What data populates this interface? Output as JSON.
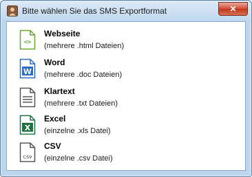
{
  "window": {
    "title": "Bitte wählen Sie das SMS Exportformat",
    "close_glyph": "✕"
  },
  "options": [
    {
      "title": "Webseite",
      "subtitle": "(mehrere .html Dateien)",
      "icon": "html-file-icon",
      "color": "#6aa52e"
    },
    {
      "title": "Word",
      "subtitle": "(mehrere .doc Dateien)",
      "icon": "word-file-icon",
      "color": "#2b6cc4"
    },
    {
      "title": "Klartext",
      "subtitle": "(mehrere .txt Dateien)",
      "icon": "text-file-icon",
      "color": "#555555"
    },
    {
      "title": "Excel",
      "subtitle": "(einzelne .xls Datei)",
      "icon": "excel-file-icon",
      "color": "#207245"
    },
    {
      "title": "CSV",
      "subtitle": "(einzelne .csv Datei)",
      "icon": "csv-file-icon",
      "color": "#555555"
    }
  ],
  "icon_glyphs": {
    "html": "<>",
    "word": "W",
    "excel": "X",
    "csv": "CSV"
  }
}
